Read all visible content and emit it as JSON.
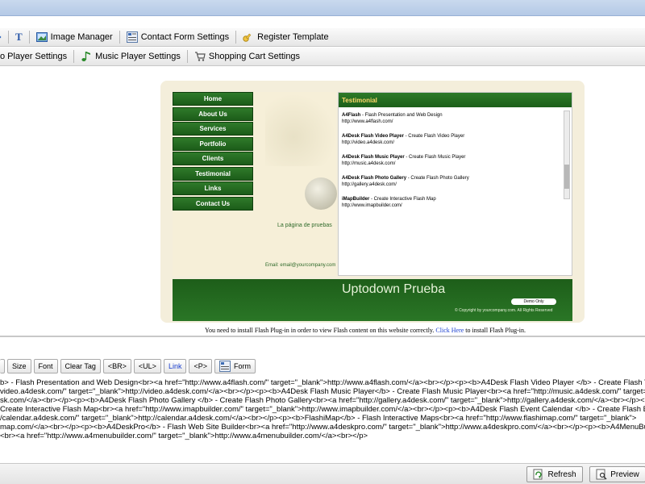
{
  "toolbar1": {
    "text_tool_glyph": "T",
    "image_manager": "Image Manager",
    "contact_form_settings": "Contact Form Settings",
    "register_template": "Register Template"
  },
  "toolbar2": {
    "video_player_settings": "o Player Settings",
    "music_player_settings": "Music Player Settings",
    "shopping_cart_settings": "Shopping Cart Settings"
  },
  "site": {
    "nav": [
      "Home",
      "About Us",
      "Services",
      "Portfolio",
      "Clients",
      "Testimonial",
      "Links",
      "Contact Us"
    ],
    "pagina": "La página de pruebas",
    "email": "Email: email@yourcompany.com",
    "testimonial_header": "Testimonial",
    "testimonials": [
      {
        "title": "A4Flash",
        "desc": " - Flash Presentation and Web Design",
        "url": "http://www.a4flash.com/"
      },
      {
        "title": "A4Desk Flash Video Player",
        "desc": " - Create Flash Video Player",
        "url": "http://video.a4desk.com/"
      },
      {
        "title": "A4Desk Flash Music Player",
        "desc": " - Create Flash Music Player",
        "url": "http://music.a4desk.com/"
      },
      {
        "title": "A4Desk Flash Photo Gallery",
        "desc": " - Create Flash Photo Gallery",
        "url": "http://gallery.a4desk.com/"
      },
      {
        "title": "iMapBuilder",
        "desc": " - Create Interactive Flash Map",
        "url": "http://www.imapbuilder.com/"
      }
    ],
    "footer_title": "Uptodown Prueba",
    "demo_only": "Demo Only",
    "copyright": "© Copyright by yourcompany.com. All Rights Reserved"
  },
  "flash_note": {
    "prefix": "You need to install Flash Plug-in in order to view Flash content on this website correctly. ",
    "link": "Click Here",
    "suffix": " to install Flash Plug-in."
  },
  "editor_toolbar": {
    "size": "Size",
    "font": "Font",
    "clear_tag": "Clear Tag",
    "br": "<BR>",
    "ul": "<UL>",
    "link": "Link",
    "p": "<P>",
    "form": "Form"
  },
  "code_lines": [
    "b> - Flash Presentation and Web Design<br><a href=\"http://www.a4flash.com/\" target=\"_blank\">http://www.a4flash.com/</a><br></p><p><b>A4Desk Flash Video Player </b> - Create Flash Video Player",
    "video.a4desk.com/\" target=\"_blank\">http://video.a4desk.com/</a><br></p><p><b>A4Desk Flash Music Player</b> - Create Flash Music Player<br><a href=\"http://music.a4desk.com/\" target=\"_blank\">",
    "sk.com/</a><br></p><p><b>A4Desk Flash Photo Gallery </b> - Create Flash Photo Gallery<br><a href=\"http://gallery.a4desk.com/\" target=\"_blank\">http://gallery.a4desk.com/</a><br></p><p><b>",
    "Create Interactive Flash Map<br><a href=\"http://www.imapbuilder.com/\" target=\"_blank\">http://www.imapbuilder.com/</a><br></p><p><b>A4Desk Flash Event Calendar </b> - Create Flash Event Calenda",
    "/calendar.a4desk.com/\" target=\"_blank\">http://calendar.a4desk.com/</a><br></p><p><b>FlashiMap</b> - Flash Interactive Maps<br><a href=\"http://www.flashimap.com/\" target=\"_blank\">",
    "map.com/</a><br></p><p><b>A4DeskPro</b> - Flash Web Site Builder<br><a href=\"http://www.a4deskpro.com/\" target=\"_blank\">http://www.a4deskpro.com/</a><br></p><p><b>A4MenuBuilder</b> -",
    "<br><a href=\"http://www.a4menubuilder.com/\" target=\"_blank\">http://www.a4menubuilder.com/</a><br></p>"
  ],
  "bottom": {
    "refresh": "Refresh",
    "preview": "Preview"
  }
}
